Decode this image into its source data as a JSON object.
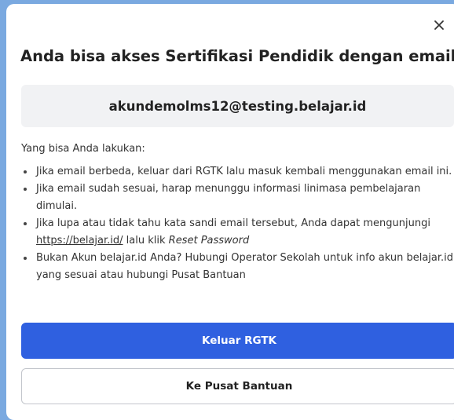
{
  "dialog": {
    "close_icon": "close-icon",
    "title": "Anda bisa akses Sertifikasi Pendidik dengan email ini",
    "email": "akundemolms12@testing.belajar.id",
    "intro": "Yang bisa Anda lakukan:",
    "items": [
      {
        "text": "Jika email berbeda, keluar dari RGTK lalu masuk kembali menggunakan email ini."
      },
      {
        "text": "Jika email sudah sesuai, harap menunggu informasi linimasa pembelajaran dimulai."
      },
      {
        "text_before": "Jika lupa atau tidak tahu kata sandi email tersebut, Anda dapat mengunjungi ",
        "link": "https://belajar.id/",
        "text_mid": " lalu klik ",
        "emphasis": "Reset Password"
      },
      {
        "text": "Bukan Akun belajar.id Anda? Hubungi Operator Sekolah untuk info akun belajar.id yang sesuai atau hubungi Pusat Bantuan"
      }
    ],
    "primary_button": "Keluar RGTK",
    "secondary_button": "Ke Pusat Bantuan",
    "colors": {
      "primary": "#2f60e0",
      "backdrop": "#7aa9e0",
      "email_bg": "#f1f2f4"
    }
  }
}
